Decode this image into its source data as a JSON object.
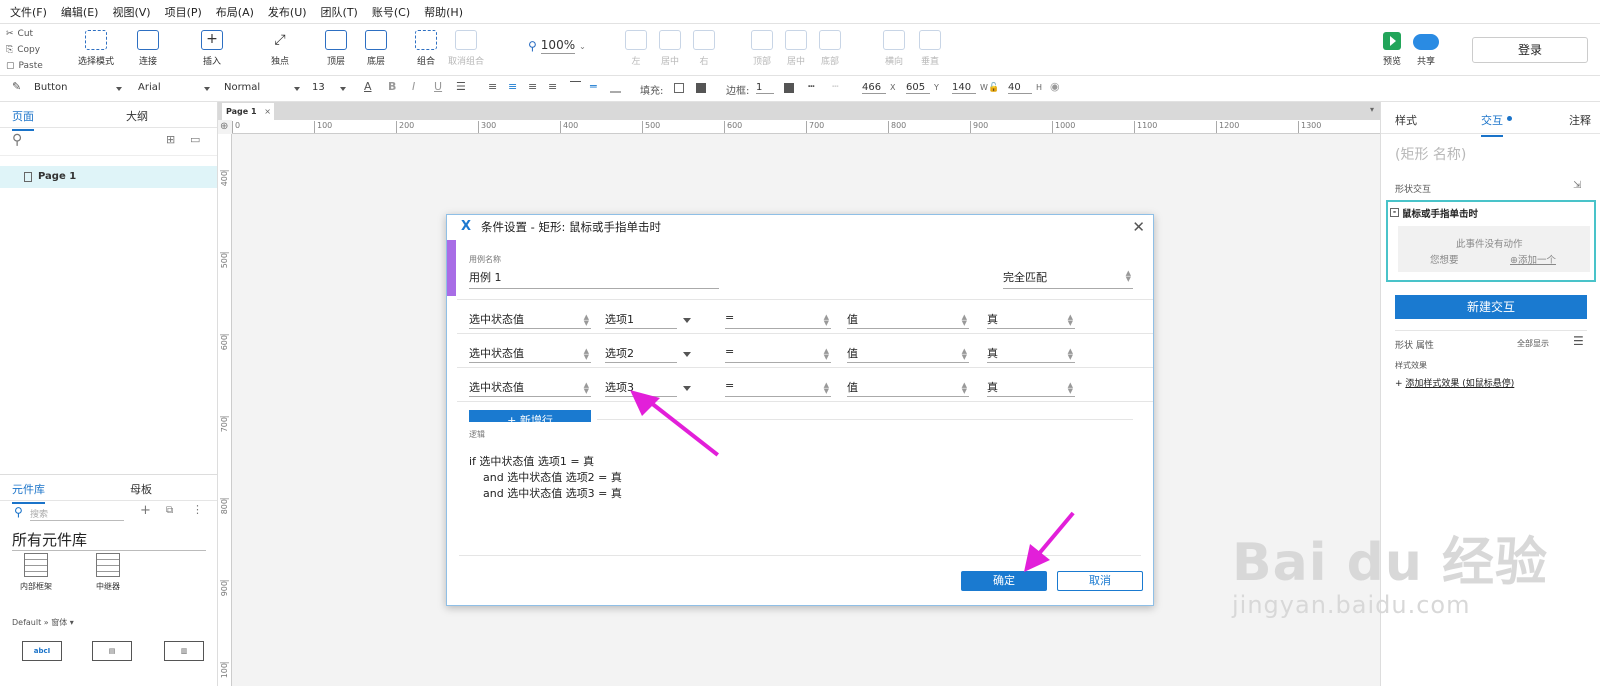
{
  "menu": [
    "文件(F)",
    "编辑(E)",
    "视图(V)",
    "项目(P)",
    "布局(A)",
    "发布(U)",
    "团队(T)",
    "账号(C)",
    "帮助(H)"
  ],
  "clipboard": {
    "cut": "Cut",
    "copy": "Copy",
    "paste": "Paste"
  },
  "toolbar": {
    "select_mode": "选择模式",
    "connect": "连接",
    "insert": "插入",
    "point": "独点",
    "top": "顶层",
    "bottom": "底层",
    "group": "组合",
    "ungroup": "取消组合",
    "zoom": "100%",
    "align_left": "左",
    "align_center": "居中",
    "align_right": "右",
    "align_top": "顶部",
    "align_middle": "居中",
    "align_bottom": "底部",
    "dist_h": "横向",
    "dist_v": "垂直",
    "preview": "预览",
    "share": "共享",
    "login": "登录"
  },
  "format": {
    "style": "Button",
    "font": "Arial",
    "weight": "Normal",
    "size": "13",
    "fill_label": "填充:",
    "border_label": "边框:",
    "border_value": "1",
    "x": "466",
    "y": "605",
    "w": "140",
    "h": "40",
    "x_label": "X",
    "y_label": "Y",
    "w_label": "W",
    "h_label": "H"
  },
  "left": {
    "tab_pages": "页面",
    "tab_outline": "大纲",
    "page1": "Page 1",
    "tab_library": "元件库",
    "tab_masters": "母板",
    "search_placeholder": "搜索",
    "library_title": "所有元件库",
    "w_inline": "内部框架",
    "w_repeater": "中继器",
    "default_lib": "Default » 窗体 ▾",
    "w_textbox": "abcI"
  },
  "canvas": {
    "tab": "Page 1",
    "ruler_h": [
      "0",
      "100",
      "200",
      "300",
      "400",
      "500",
      "600",
      "700",
      "800",
      "900",
      "1000",
      "1100",
      "1200",
      "1300"
    ],
    "ruler_v": [
      "400",
      "500",
      "600",
      "700",
      "800",
      "900",
      "100"
    ]
  },
  "dialog": {
    "title": "条件设置  -  矩形: 鼠标或手指单击时",
    "case_label": "用例名称",
    "case_name": "用例 1",
    "match": "完全匹配",
    "rows": [
      {
        "a": "选中状态值",
        "b": "选项1",
        "op": "=",
        "c": "值",
        "d": "真"
      },
      {
        "a": "选中状态值",
        "b": "选项2",
        "op": "=",
        "c": "值",
        "d": "真"
      },
      {
        "a": "选中状态值",
        "b": "选项3",
        "op": "=",
        "c": "值",
        "d": "真"
      }
    ],
    "add_row": "+ 新增行",
    "logic_label": "逻辑",
    "logic": [
      "if 选中状态值 选项1 = 真",
      "and 选中状态值 选项2 = 真",
      "and 选中状态值 选项3 = 真"
    ],
    "ok": "确定",
    "cancel": "取消"
  },
  "right": {
    "tab_style": "样式",
    "tab_interact": "交互",
    "tab_notes": "注释",
    "shape_name": "(矩形 名称)",
    "shape_interact": "形状交互",
    "event": "鼠标或手指单击时",
    "no_action": "此事件没有动作",
    "want": "您想要",
    "add_one": "添加一个",
    "new_interaction": "新建交互",
    "shape_props": "形状 属性",
    "show_all": "全部显示",
    "style_effects": "样式效果",
    "add_effect": "添加样式效果 (如鼠标悬停)"
  },
  "colors": {
    "accent": "#1a7ad0",
    "arrow": "#e21fd9",
    "highlight": "#49c3c9",
    "purple": "#a86de6"
  },
  "watermark": {
    "line1": "Bai du 经验",
    "line2": "jingyan.baidu.com"
  }
}
